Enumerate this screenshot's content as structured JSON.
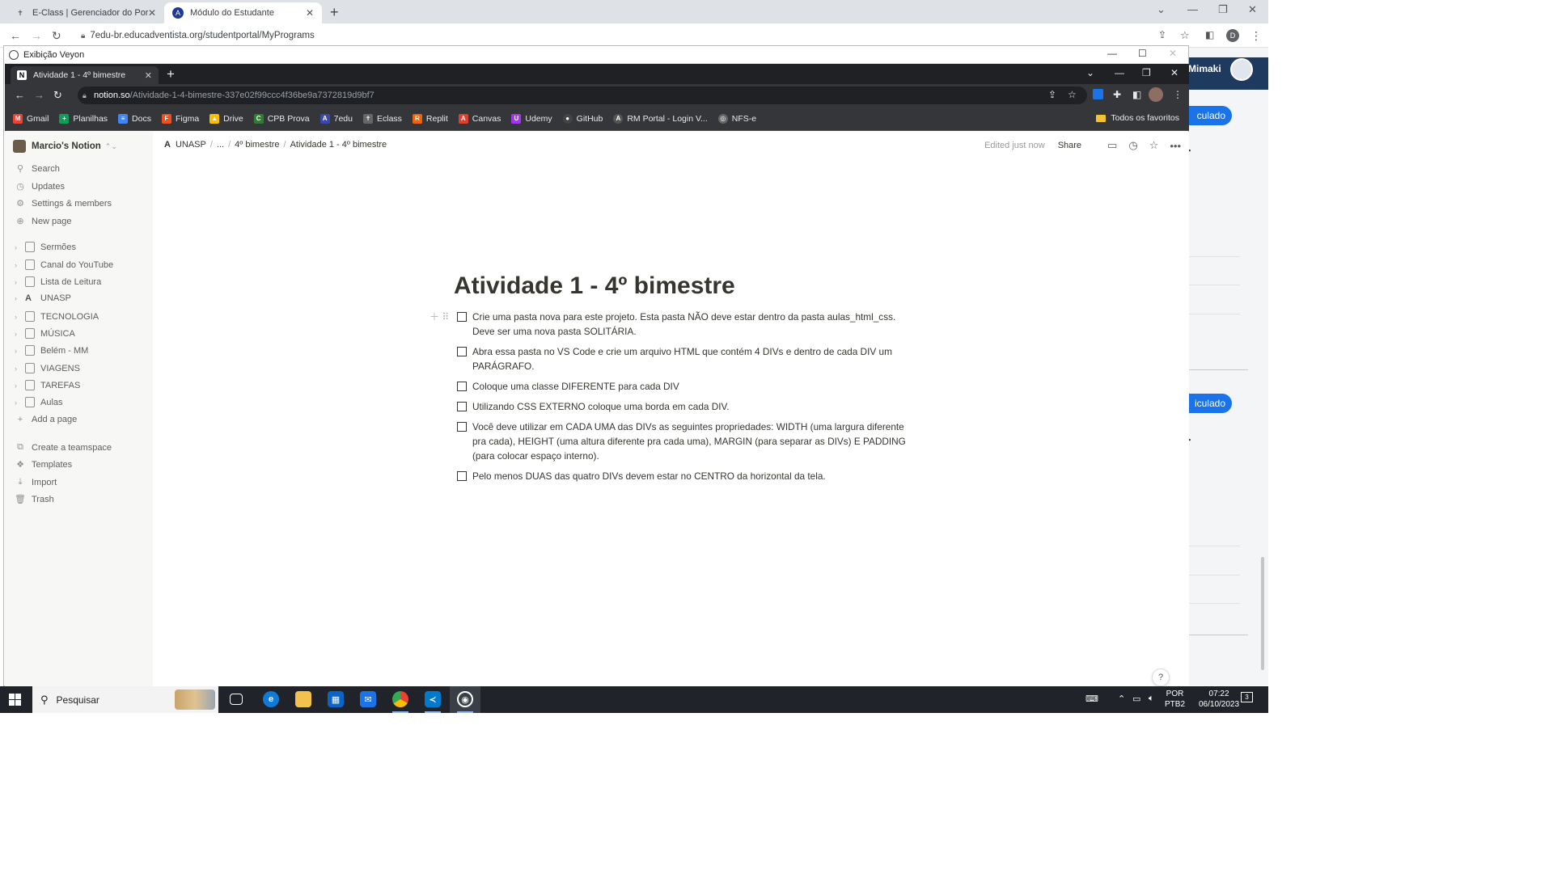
{
  "outer_browser": {
    "tabs": [
      {
        "title": "E-Class | Gerenciador do Portal c"
      },
      {
        "title": "Módulo do Estudante"
      }
    ],
    "url": "7edu-br.educadventista.org/studentportal/MyPrograms"
  },
  "background_page": {
    "user_name": "Mimaki",
    "pill_1": "culado",
    "pill_2": "iculado"
  },
  "veyon": {
    "title": "Exibição Veyon"
  },
  "inner_browser": {
    "tab_title": "Atividade 1 - 4º bimestre",
    "url_host": "notion.so",
    "url_path": "/Atividade-1-4-bimestre-337e02f99ccc4f36be9a7372819d9bf7",
    "bookmarks": [
      {
        "label": "Gmail",
        "color": "#ea4335"
      },
      {
        "label": "Planilhas",
        "color": "#0f9d58"
      },
      {
        "label": "Docs",
        "color": "#4285f4"
      },
      {
        "label": "Figma",
        "color": "#f24e1e"
      },
      {
        "label": "Drive",
        "color": "#fbbc04"
      },
      {
        "label": "CPB Prova",
        "color": "#2e7d32"
      },
      {
        "label": "7edu",
        "color": "#3949ab"
      },
      {
        "label": "Eclass",
        "color": "#666666"
      },
      {
        "label": "Replit",
        "color": "#f26207"
      },
      {
        "label": "Canvas",
        "color": "#e13f2b"
      },
      {
        "label": "Udemy",
        "color": "#a435f0"
      },
      {
        "label": "GitHub",
        "color": "#444444"
      },
      {
        "label": "RM Portal - Login V...",
        "color": "#555555"
      },
      {
        "label": "NFS-e",
        "color": "#666666"
      }
    ],
    "favorites_label": "Todos os favoritos"
  },
  "notion": {
    "workspace": "Marcio's Notion",
    "menu": [
      {
        "label": "Search",
        "icon": "search-icon"
      },
      {
        "label": "Updates",
        "icon": "clock-icon"
      },
      {
        "label": "Settings & members",
        "icon": "gear-icon"
      },
      {
        "label": "New page",
        "icon": "plus-circle-icon"
      }
    ],
    "pages": [
      "Sermões",
      "Canal do YouTube",
      "Lista de Leitura",
      "UNASP",
      "TECNOLOGIA",
      "MÚSICA",
      "Belém - MM",
      "VIAGENS",
      "TAREFAS",
      "Aulas"
    ],
    "add_page": "Add a page",
    "bottom_menu": [
      "Create a teamspace",
      "Templates",
      "Import",
      "Trash"
    ],
    "breadcrumb": [
      "UNASP",
      "...",
      "4º bimestre",
      "Atividade 1 - 4º bimestre"
    ],
    "edited": "Edited just now",
    "share": "Share",
    "page_title": "Atividade 1 - 4º bimestre",
    "todos": [
      "Crie uma pasta nova para este projeto. Esta pasta NÃO deve estar dentro da pasta aulas_html_css. Deve ser uma nova pasta SOLITÁRIA.",
      "Abra essa pasta no VS Code e crie um arquivo HTML que contém 4 DIVs e dentro de cada DIV um PARÁGRAFO.",
      "Coloque uma classe DIFERENTE para cada DIV",
      "Utilizando CSS EXTERNO coloque uma borda em cada DIV.",
      "Você deve utilizar em CADA UMA das DIVs as seguintes propriedades: WIDTH (uma largura diferente pra cada), HEIGHT (uma altura diferente pra cada uma), MARGIN (para separar as DIVs) E PADDING (para colocar espaço interno).",
      "Pelo menos DUAS das quatro DIVs devem estar no CENTRO da horizontal da tela."
    ],
    "help": "?"
  },
  "taskbar": {
    "search_placeholder": "Pesquisar",
    "lang_1": "POR",
    "lang_2": "PTB2",
    "time": "07:22",
    "date": "06/10/2023",
    "notifications": "3"
  }
}
